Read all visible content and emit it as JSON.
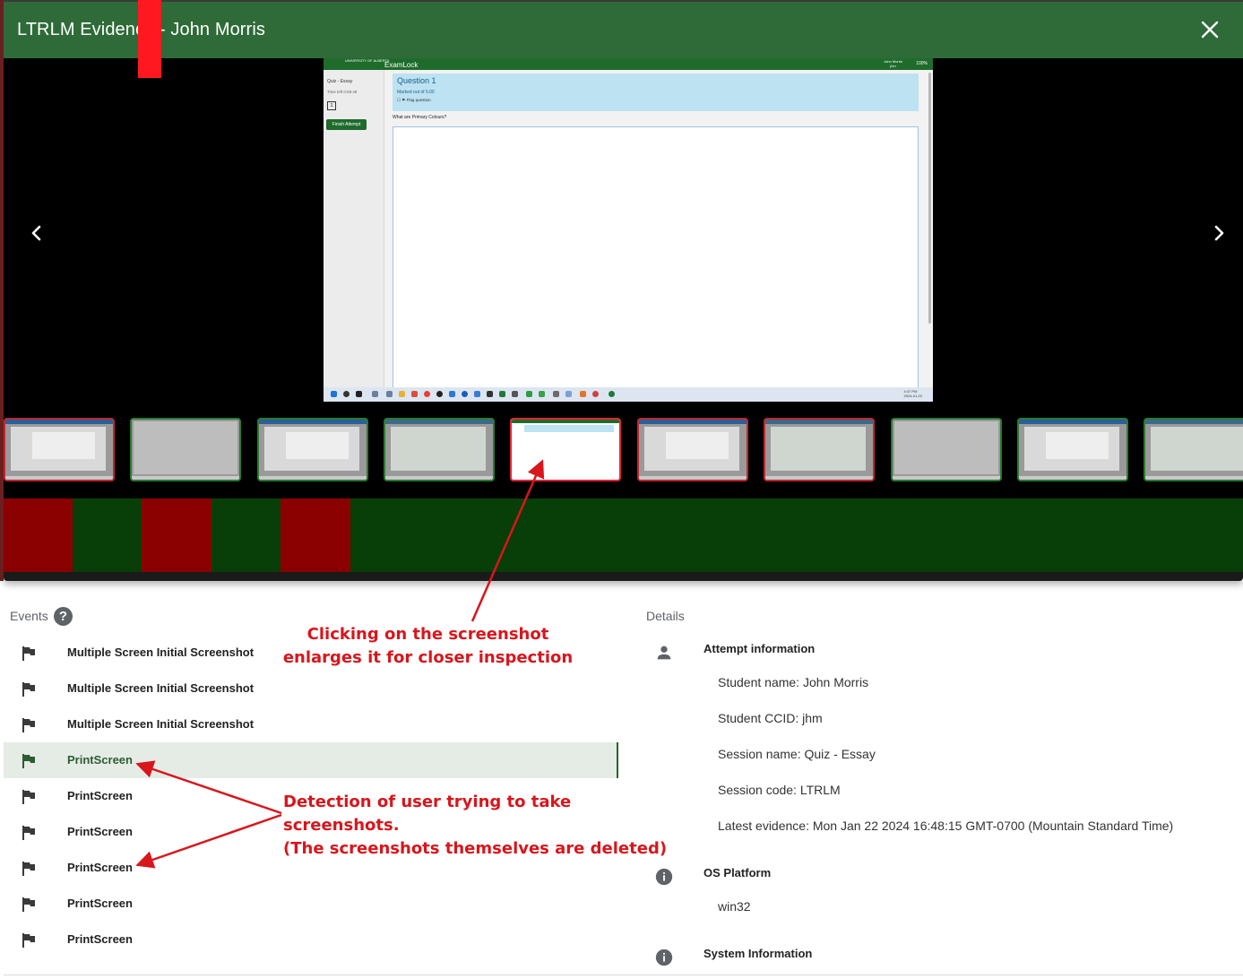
{
  "dialog": {
    "title": "LTRLM Evidence - John Morris",
    "close_icon": "close-icon"
  },
  "viewer": {
    "prev_icon": "chevron-left-icon",
    "next_icon": "chevron-right-icon",
    "screenshot": {
      "brand_small": "UNIVERSITY OF ALBERTA",
      "brand": "ExamLock",
      "user_name": "John Morris",
      "user_id": "jhm",
      "battery": "100%",
      "quiz_title": "Quiz - Essay",
      "time_left": "Time left 0:59:48",
      "nav_number": "1",
      "finish_label": "Finish Attempt",
      "question_title": "Question 1",
      "marked_out_of": "Marked out of 5.00",
      "flag_question": "Flag question",
      "prompt": "What are Primary Colours?",
      "clock_time": "4:47 PM",
      "clock_date": "2024-01-22"
    }
  },
  "thumbnails": [
    {
      "status": "red",
      "style": "sheet"
    },
    {
      "status": "green",
      "style": "plain"
    },
    {
      "status": "green",
      "style": "sheet"
    },
    {
      "status": "green",
      "style": "app"
    },
    {
      "status": "red",
      "style": "active"
    },
    {
      "status": "red",
      "style": "sheet"
    },
    {
      "status": "red",
      "style": "app"
    },
    {
      "status": "green",
      "style": "plain"
    },
    {
      "status": "green",
      "style": "sheet"
    },
    {
      "status": "green",
      "style": "app"
    }
  ],
  "timeline": {
    "colors": {
      "red": "#8b0000",
      "green": "#083e08",
      "marker": "#ff1820"
    },
    "segments": [
      "red",
      "green",
      "red",
      "red",
      "green",
      "red",
      "green"
    ]
  },
  "events": {
    "label": "Events",
    "help_icon": "?",
    "items": [
      {
        "label": "Multiple Screen Initial Screenshot",
        "selected": false
      },
      {
        "label": "Multiple Screen Initial Screenshot",
        "selected": false
      },
      {
        "label": "Multiple Screen Initial Screenshot",
        "selected": false
      },
      {
        "label": "PrintScreen",
        "selected": true
      },
      {
        "label": "PrintScreen",
        "selected": false
      },
      {
        "label": "PrintScreen",
        "selected": false
      },
      {
        "label": "PrintScreen",
        "selected": false
      },
      {
        "label": "PrintScreen",
        "selected": false
      },
      {
        "label": "PrintScreen",
        "selected": false
      }
    ]
  },
  "details": {
    "label": "Details",
    "attempt": {
      "icon": "person-icon",
      "title": "Attempt information",
      "lines": [
        "Student name: John Morris",
        "Student CCID: jhm",
        "Session name: Quiz - Essay",
        "Session code: LTRLM",
        "Latest evidence: Mon Jan 22 2024 16:48:15 GMT-0700 (Mountain Standard Time)"
      ]
    },
    "os": {
      "icon": "info-icon",
      "title": "OS Platform",
      "value": "win32"
    },
    "system": {
      "icon": "info-icon",
      "title": "System Information"
    }
  },
  "annotations": {
    "screenshot_note_1": "Clicking on the screenshot",
    "screenshot_note_2": "enlarges it for closer inspection",
    "detection_note_1": "Detection of user trying to take screenshots.",
    "detection_note_2": "(The screenshots themselves are deleted)"
  }
}
